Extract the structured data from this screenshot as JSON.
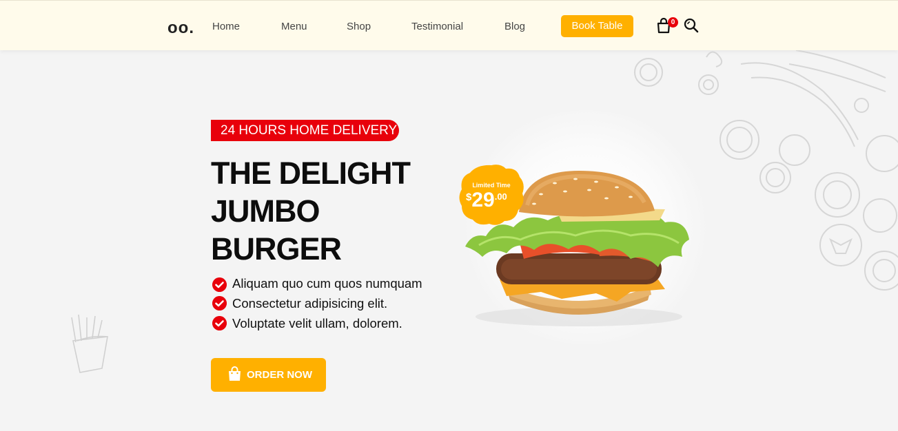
{
  "header": {
    "logo": "oo.",
    "nav": [
      {
        "label": "Home"
      },
      {
        "label": "Menu"
      },
      {
        "label": "Shop"
      },
      {
        "label": "Testimonial"
      },
      {
        "label": "Blog"
      }
    ],
    "book_label": "Book Table",
    "cart_count": "0",
    "icons": [
      "shopping-bag-icon",
      "search-icon"
    ]
  },
  "hero": {
    "badge": "24 HOURS HOME DELIVERY",
    "title_lines": [
      "THE DELIGHT",
      "JUMBO",
      "BURGER"
    ],
    "features": [
      "Aliquam quo cum quos numquam",
      "Consectetur adipisicing elit.",
      "Voluptate velit ullam, dolorem."
    ],
    "order_label": "ORDER NOW",
    "offer": {
      "label": "Limited Time",
      "currency": "$",
      "amount": "29",
      "cents": ".00"
    }
  },
  "colors": {
    "accent": "#ffb000",
    "red": "#e8000b",
    "header_bg": "#fffbeb",
    "page_bg": "#f4f4f4"
  }
}
